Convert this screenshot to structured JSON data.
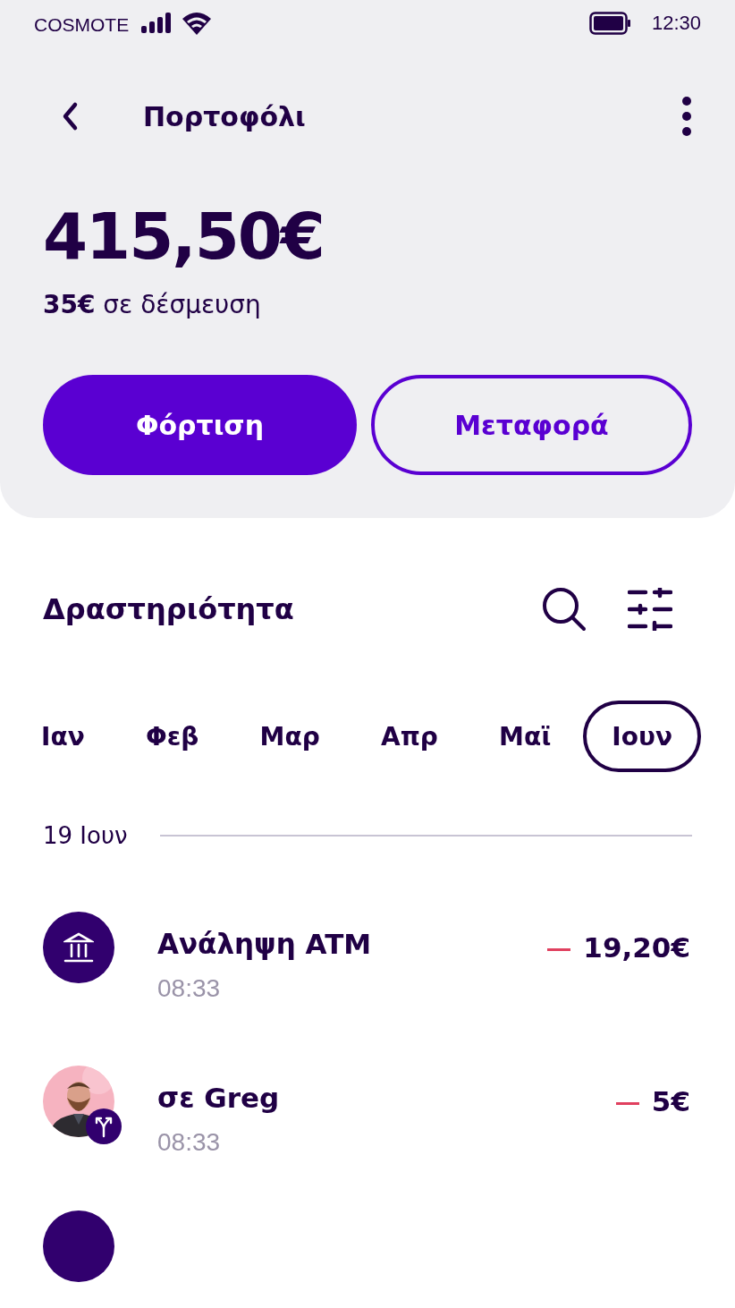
{
  "status_bar": {
    "carrier": "COSMOTE",
    "time": "12:30"
  },
  "header": {
    "title": "Πορτοφόλι"
  },
  "balance": {
    "amount": "415,50€",
    "held": "**35€** σε δέσμευση"
  },
  "actions": [
    {
      "label": "Φόρτιση",
      "kind": "primary"
    },
    {
      "label": "Μεταφορά",
      "kind": "secondary"
    }
  ],
  "activity": {
    "title": "Δραστηριότητα"
  },
  "months": [
    {
      "label": "Ιαν",
      "selected": false
    },
    {
      "label": "Φεβ",
      "selected": false
    },
    {
      "label": "Μαρ",
      "selected": false
    },
    {
      "label": "Απρ",
      "selected": false
    },
    {
      "label": "Μαϊ",
      "selected": false
    },
    {
      "label": "Ιουν",
      "selected": true
    }
  ],
  "date_group": "19 Ιουν",
  "transactions": [
    {
      "kind": "bank",
      "title": "Ανάληψη ATM",
      "time": "08:33",
      "amount": "19,20€"
    },
    {
      "kind": "person",
      "title": "σε Greg",
      "time": "08:33",
      "amount": "5€"
    },
    {
      "kind": "cut"
    }
  ]
}
